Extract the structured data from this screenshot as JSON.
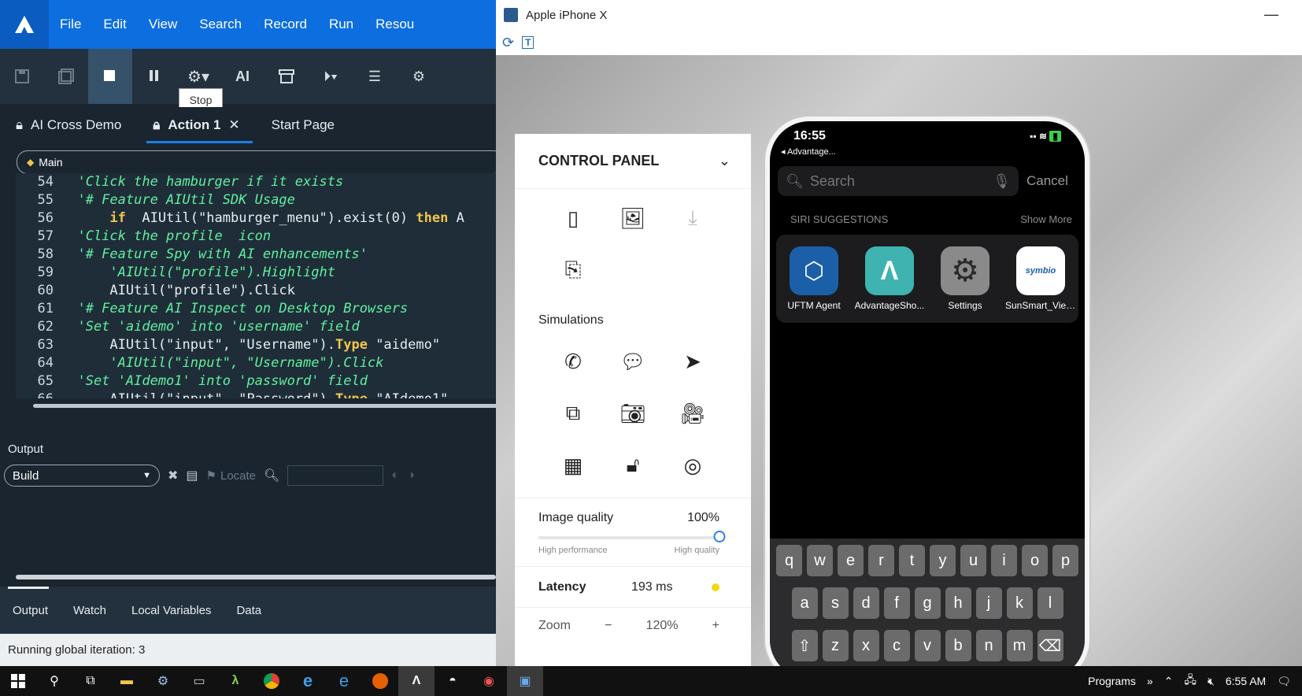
{
  "menubar": {
    "items": [
      "File",
      "Edit",
      "View",
      "Search",
      "Record",
      "Run",
      "Resou"
    ]
  },
  "toolbar": {
    "ai_label": "AI",
    "tooltip": "Stop"
  },
  "doc_tabs": [
    {
      "label": "AI Cross Demo"
    },
    {
      "label": "Action 1"
    },
    {
      "label": "Start Page"
    }
  ],
  "scope": {
    "label": "Main"
  },
  "code": {
    "lines": [
      {
        "n": "54",
        "parts": [
          {
            "t": "  'Click the hamburger if it exists",
            "c": "cm"
          }
        ]
      },
      {
        "n": "55",
        "parts": [
          {
            "t": "  '# Feature AIUtil SDK Usage",
            "c": "cm"
          }
        ]
      },
      {
        "n": "56",
        "parts": [
          {
            "t": "      ",
            "c": "cc"
          },
          {
            "t": "if",
            "c": "kw"
          },
          {
            "t": "  AIUtil(\"hamburger_menu\").exist(0) ",
            "c": "cc"
          },
          {
            "t": "then",
            "c": "kw"
          },
          {
            "t": " A",
            "c": "cc"
          }
        ]
      },
      {
        "n": "57",
        "parts": [
          {
            "t": "  'Click the profile  icon",
            "c": "cm"
          }
        ]
      },
      {
        "n": "58",
        "parts": [
          {
            "t": "  '# Feature Spy with AI enhancements'",
            "c": "cm"
          }
        ]
      },
      {
        "n": "59",
        "parts": [
          {
            "t": "      'AIUtil(\"profile\").Highlight",
            "c": "cm"
          }
        ]
      },
      {
        "n": "60",
        "parts": [
          {
            "t": "      AIUtil(\"profile\").Click",
            "c": "cc"
          }
        ]
      },
      {
        "n": "61",
        "parts": [
          {
            "t": "  '# Feature AI Inspect on Desktop Browsers",
            "c": "cm"
          }
        ]
      },
      {
        "n": "62",
        "parts": [
          {
            "t": "  'Set 'aidemo' into 'username' field",
            "c": "cm"
          }
        ]
      },
      {
        "n": "63",
        "parts": [
          {
            "t": "      AIUtil(\"input\", \"Username\").",
            "c": "cc"
          },
          {
            "t": "Type",
            "c": "kw"
          },
          {
            "t": " \"aidemo\"",
            "c": "cc"
          }
        ]
      },
      {
        "n": "64",
        "parts": [
          {
            "t": "      'AIUtil(\"input\", \"Username\").Click",
            "c": "cm"
          }
        ]
      },
      {
        "n": "65",
        "parts": [
          {
            "t": "  'Set 'AIdemo1' into 'password' field",
            "c": "cm"
          }
        ]
      },
      {
        "n": "66",
        "parts": [
          {
            "t": "      AIUtil(\"input\", \"Password\").",
            "c": "cc"
          },
          {
            "t": "Type",
            "c": "kw"
          },
          {
            "t": " \"AIdemo1\"",
            "c": "cc"
          }
        ]
      }
    ]
  },
  "output": {
    "title": "Output",
    "filter_value": "Build",
    "locate_label": "Locate"
  },
  "bottom_tabs": [
    {
      "label": "Output"
    },
    {
      "label": "Watch"
    },
    {
      "label": "Local Variables"
    },
    {
      "label": "Data"
    }
  ],
  "status": {
    "text": "Running global iteration: 3"
  },
  "mirror": {
    "title": "Apple iPhone X"
  },
  "control_panel": {
    "title": "CONTROL PANEL",
    "simulations_label": "Simulations",
    "image_quality_label": "Image quality",
    "image_quality_value": "100%",
    "image_quality_fraction": 1.0,
    "slider_left_label": "High performance",
    "slider_right_label": "High quality",
    "latency_label": "Latency",
    "latency_value": "193 ms",
    "zoom_label": "Zoom",
    "zoom_value": "120%"
  },
  "phone": {
    "time": "16:55",
    "back_label": "◂ Advantage...",
    "search_placeholder": "Search",
    "cancel_label": "Cancel",
    "siri_label": "SIRI SUGGESTIONS",
    "show_more_label": "Show More",
    "apps": [
      {
        "label": "UFTM Agent",
        "color": "#1b5fa8"
      },
      {
        "label": "AdvantageSho...",
        "color": "#3fb3b0"
      },
      {
        "label": "Settings",
        "color": "#8a8a8a"
      },
      {
        "label": "SunSmart_Viet...",
        "color": "#ffffff"
      }
    ],
    "keys_row1": [
      "q",
      "w",
      "e",
      "r",
      "t",
      "y",
      "u",
      "i",
      "o",
      "p"
    ],
    "keys_row2": [
      "a",
      "s",
      "d",
      "f",
      "g",
      "h",
      "j",
      "k",
      "l"
    ],
    "keys_row3": [
      "⇧",
      "z",
      "x",
      "c",
      "v",
      "b",
      "n",
      "m",
      "⌫"
    ]
  },
  "taskbar": {
    "programs_label": "Programs",
    "time": "6:55 AM"
  },
  "colors": {
    "accent": "#0d6ee0",
    "ide_bg": "#1a2530",
    "comment": "#5ff0a0",
    "keyword": "#f2c44d",
    "latency_dot": "#f5d90a"
  }
}
